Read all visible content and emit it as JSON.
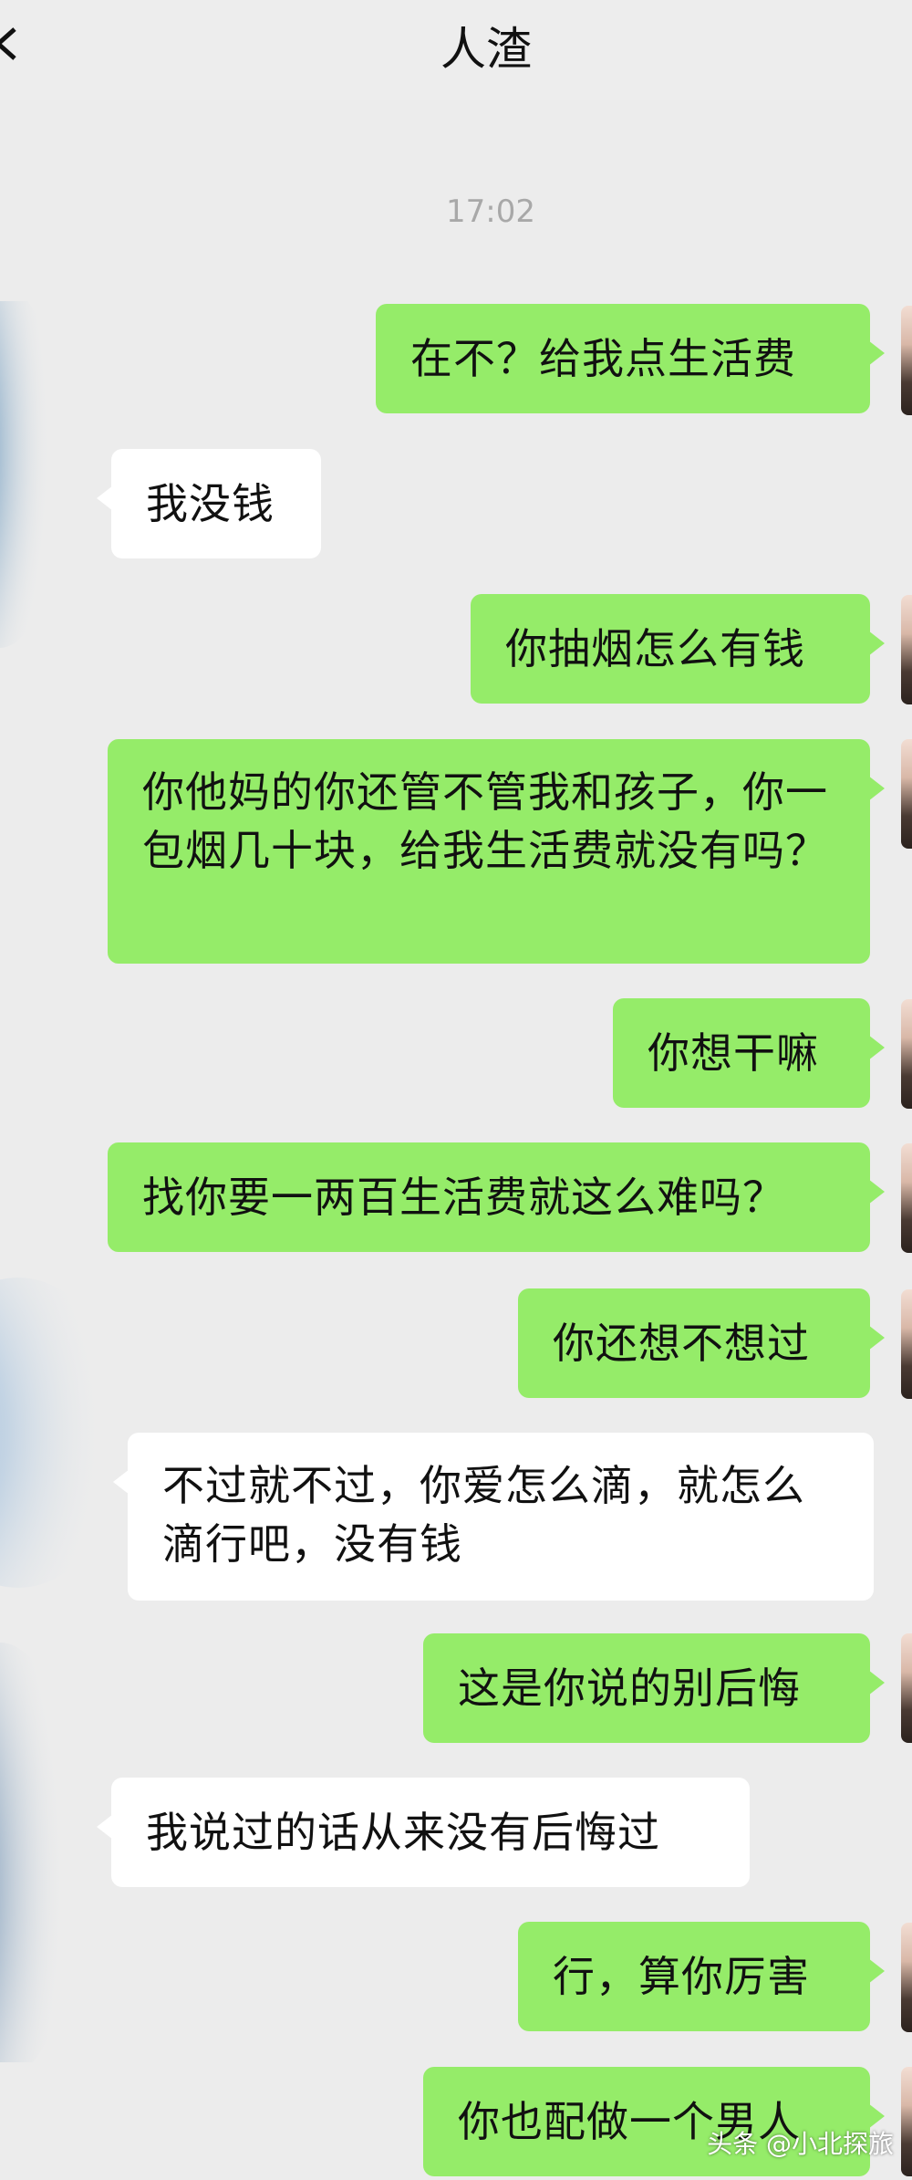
{
  "header": {
    "title": "人渣"
  },
  "timestamp": "17:02",
  "messages": [
    {
      "from": "me",
      "text": "在不？给我点生活费"
    },
    {
      "from": "other",
      "text": "我没钱"
    },
    {
      "from": "me",
      "text": "你抽烟怎么有钱"
    },
    {
      "from": "me",
      "text": "你他妈的你还管不管我和孩子，你一包烟几十块，给我生活费就没有吗？"
    },
    {
      "from": "me",
      "text": "你想干嘛"
    },
    {
      "from": "me",
      "text": "找你要一两百生活费就这么难吗？"
    },
    {
      "from": "me",
      "text": "你还想不想过"
    },
    {
      "from": "other",
      "text": "不过就不过，你爱怎么滴，就怎么滴行吧，没有钱"
    },
    {
      "from": "me",
      "text": "这是你说的别后悔"
    },
    {
      "from": "other",
      "text": "我说过的话从来没有后悔过"
    },
    {
      "from": "me",
      "text": "行，算你厉害"
    },
    {
      "from": "me",
      "text": "你也配做一个男人"
    }
  ],
  "watermark": "头条 @小北探旅",
  "icons": {
    "back": "chevron-left-icon",
    "avatar": "avatar"
  },
  "colors": {
    "sent_bubble": "#95ec69",
    "received_bubble": "#ffffff",
    "background": "#ececec"
  }
}
